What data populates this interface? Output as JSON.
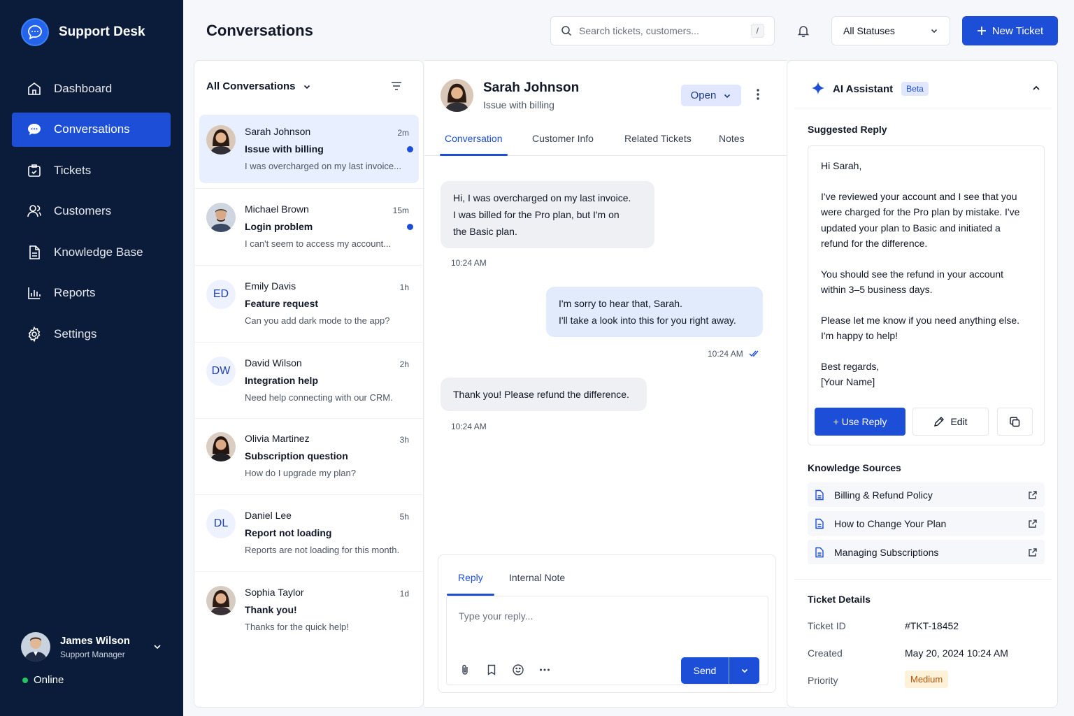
{
  "app": {
    "name": "Support Desk"
  },
  "nav": {
    "items": [
      {
        "label": "Dashboard",
        "icon": "home-icon"
      },
      {
        "label": "Conversations",
        "icon": "chat-icon",
        "active": true
      },
      {
        "label": "Tickets",
        "icon": "ticket-icon"
      },
      {
        "label": "Customers",
        "icon": "users-icon"
      },
      {
        "label": "Knowledge Base",
        "icon": "document-icon"
      },
      {
        "label": "Reports",
        "icon": "bar-chart-icon"
      },
      {
        "label": "Settings",
        "icon": "gear-icon"
      }
    ]
  },
  "current_user": {
    "name": "James Wilson",
    "role": "Support Manager",
    "status": "Online"
  },
  "header": {
    "title": "Conversations",
    "search_placeholder": "Search tickets, customers...",
    "search_shortcut": "/",
    "status_filter": "All Statuses",
    "new_ticket_label": "New Ticket"
  },
  "conversation_list": {
    "filter_label": "All Conversations",
    "items": [
      {
        "name": "Sarah Johnson",
        "time": "2m",
        "subject": "Issue with billing",
        "preview": "I was overcharged on my last invoice...",
        "unread": true,
        "active": true,
        "avatar": "photo"
      },
      {
        "name": "Michael Brown",
        "time": "15m",
        "subject": "Login problem",
        "preview": "I can't seem to access my account...",
        "unread": true,
        "active": false,
        "avatar": "photo"
      },
      {
        "name": "Emily Davis",
        "time": "1h",
        "subject": "Feature request",
        "preview": "Can you add dark mode to the app?",
        "unread": false,
        "active": false,
        "initials": "ED"
      },
      {
        "name": "David Wilson",
        "time": "2h",
        "subject": "Integration help",
        "preview": "Need help connecting with our CRM.",
        "unread": false,
        "active": false,
        "initials": "DW"
      },
      {
        "name": "Olivia Martinez",
        "time": "3h",
        "subject": "Subscription question",
        "preview": "How do I upgrade my plan?",
        "unread": false,
        "active": false,
        "avatar": "photo"
      },
      {
        "name": "Daniel Lee",
        "time": "5h",
        "subject": "Report not loading",
        "preview": "Reports are not loading for this month.",
        "unread": false,
        "active": false,
        "initials": "DL"
      },
      {
        "name": "Sophia Taylor",
        "time": "1d",
        "subject": "Thank you!",
        "preview": "Thanks for the quick help!",
        "unread": false,
        "active": false,
        "avatar": "photo"
      }
    ]
  },
  "chat": {
    "customer_name": "Sarah Johnson",
    "subject": "Issue with billing",
    "status": "Open",
    "tabs": [
      "Conversation",
      "Customer Info",
      "Related Tickets",
      "Notes"
    ],
    "messages": [
      {
        "direction": "in",
        "lines": [
          "Hi, I was overcharged on my last invoice.",
          "I was billed for the Pro plan, but I'm on",
          "the Basic plan."
        ],
        "time": "10:24 AM"
      },
      {
        "direction": "out",
        "lines": [
          "I'm sorry to hear that, Sarah.",
          "I'll take a look into this for you right away."
        ],
        "time": "10:24 AM",
        "read": true
      },
      {
        "direction": "in",
        "lines": [
          "Thank you! Please refund the difference."
        ],
        "time": "10:24 AM"
      }
    ],
    "reply": {
      "tabs": [
        "Reply",
        "Internal Note"
      ],
      "placeholder": "Type your reply...",
      "send_label": "Send"
    }
  },
  "ai_assistant": {
    "title": "AI Assistant",
    "badge": "Beta",
    "suggested_reply_title": "Suggested Reply",
    "suggested_reply": [
      "Hi Sarah,",
      "I've reviewed your account and I see that you were charged for the Pro plan by mistake. I've updated your plan to Basic and initiated a refund for the difference.",
      "You should see the refund in your account within 3–5 business days.",
      "Please let me know if you need anything else. I'm happy to help!",
      "Best regards,\n[Your Name]"
    ],
    "use_reply_label": "+ Use Reply",
    "edit_label": "Edit",
    "knowledge_title": "Knowledge Sources",
    "sources": [
      "Billing & Refund Policy",
      "How to Change Your Plan",
      "Managing Subscriptions"
    ],
    "ticket_details_title": "Ticket Details",
    "details": {
      "ticket_id_label": "Ticket ID",
      "ticket_id": "#TKT-18452",
      "created_label": "Created",
      "created": "May 20, 2024 10:24 AM",
      "priority_label": "Priority",
      "priority": "Medium"
    }
  },
  "colors": {
    "sidebar": "#0b1c3a",
    "accent": "#1d4ed8",
    "online": "#22c55e",
    "priority_medium": "#fdf1d8"
  }
}
